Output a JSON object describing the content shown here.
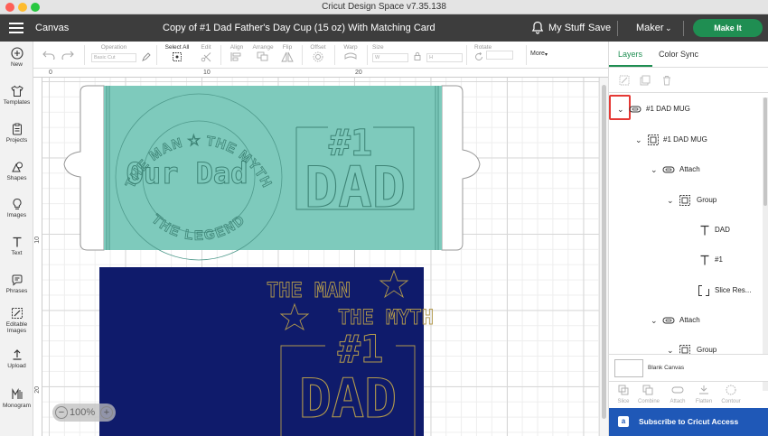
{
  "window": {
    "title": "Cricut Design Space  v7.35.138"
  },
  "header": {
    "canvas_label": "Canvas",
    "project_title": "Copy of #1 Dad Father's Day Cup (15 oz) With Matching Card",
    "my_stuff": "My Stuff",
    "save": "Save",
    "machine": "Maker",
    "make_it": "Make It"
  },
  "leftnav": {
    "new": "New",
    "templates": "Templates",
    "projects": "Projects",
    "shapes": "Shapes",
    "images": "Images",
    "text": "Text",
    "phrases": "Phrases",
    "editable_images_1": "Editable",
    "editable_images_2": "Images",
    "upload": "Upload",
    "monogram": "Monogram"
  },
  "toolbar": {
    "operation": "Operation",
    "operation_value": "Basic Cut",
    "select_all": "Select All",
    "edit": "Edit",
    "align": "Align",
    "arrange": "Arrange",
    "flip": "Flip",
    "offset": "Offset",
    "warp": "Warp",
    "size": "Size",
    "size_w": "W",
    "size_h": "H",
    "rotate": "Rotate",
    "more": "More"
  },
  "ruler": {
    "top": [
      "0",
      "10",
      "20"
    ],
    "left": [
      "10",
      "20"
    ]
  },
  "zoom": {
    "value": "100%",
    "minus": "−",
    "plus": "+"
  },
  "canvas": {
    "cup": {
      "circle_top": "THE MAN ★ THE MYTH",
      "circle_bottom": "THE LEGEND",
      "center": "Our Dad",
      "num": "#1",
      "dad": "DAD",
      "fill": "#7ecabc",
      "stroke": "#4f9a8c"
    },
    "card": {
      "the_man": "THE MAN",
      "the_myth": "THE MYTH",
      "num": "#1",
      "dad": "DAD",
      "fill": "#0f1b6b",
      "stroke": "#b39a4c"
    }
  },
  "rightpanel": {
    "tab_layers": "Layers",
    "tab_color_sync": "Color Sync",
    "layers": [
      {
        "label": "#1 DAD MUG",
        "level": 0
      },
      {
        "label": "#1 DAD MUG",
        "level": 1
      },
      {
        "label": "Attach",
        "level": 2
      },
      {
        "label": "Group",
        "level": 3
      },
      {
        "label": "DAD",
        "level": 4
      },
      {
        "label": "#1",
        "level": 4
      },
      {
        "label": "Slice Res...",
        "level": 4
      },
      {
        "label": "Attach",
        "level": 2
      },
      {
        "label": "Group",
        "level": 3
      }
    ],
    "blank_canvas": "Blank Canvas",
    "actions": {
      "slice": "Slice",
      "combine": "Combine",
      "attach": "Attach",
      "flatten": "Flatten",
      "contour": "Contour"
    },
    "subscribe": "Subscribe to Cricut Access",
    "subscribe_icon": "a"
  },
  "colors": {
    "accent": "#1f8e52",
    "header_bg": "#3d3d3d",
    "highlight": "#e53935",
    "subscribe_bg": "#1f58b7"
  }
}
